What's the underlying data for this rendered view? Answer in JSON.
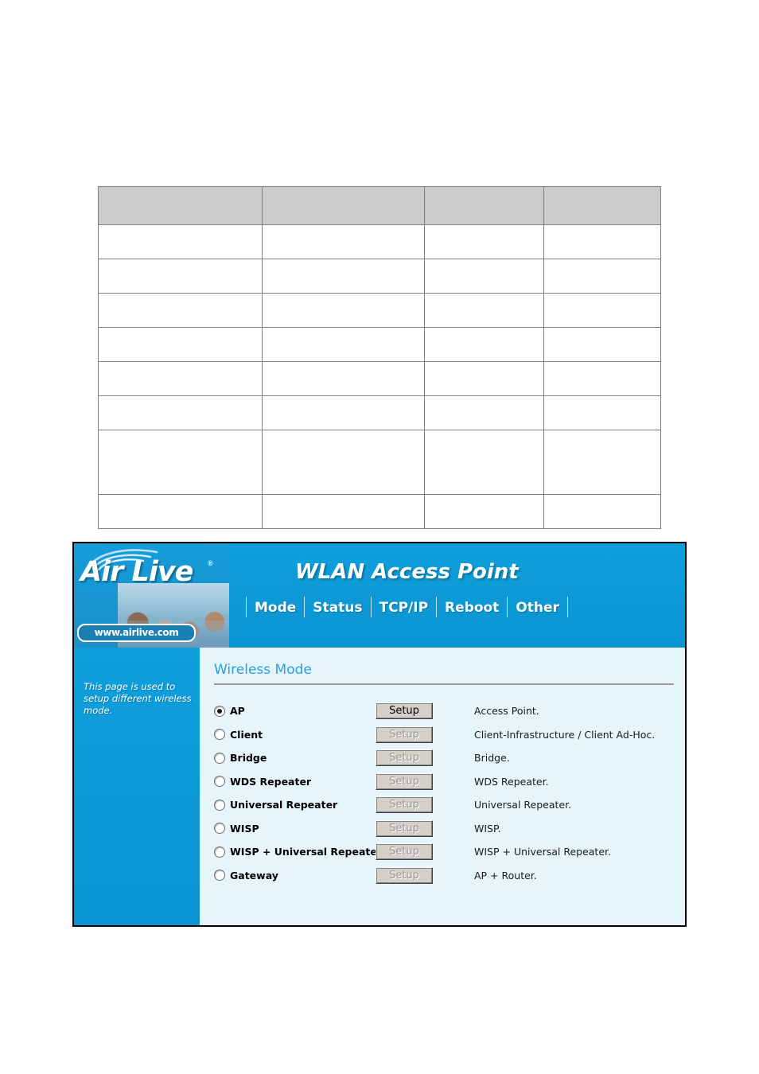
{
  "spec_table": {
    "header_cells": [
      "",
      "",
      "",
      ""
    ],
    "rows": [
      {
        "cells": [
          "",
          "",
          "",
          ""
        ],
        "tall": false
      },
      {
        "cells": [
          "",
          "",
          "",
          ""
        ],
        "tall": false
      },
      {
        "cells": [
          "",
          "",
          "",
          ""
        ],
        "tall": false
      },
      {
        "cells": [
          "",
          "",
          "",
          ""
        ],
        "tall": false
      },
      {
        "cells": [
          "",
          "",
          "",
          ""
        ],
        "tall": false
      },
      {
        "cells": [
          "",
          "",
          "",
          ""
        ],
        "tall": false
      },
      {
        "cells": [
          "",
          "",
          "",
          ""
        ],
        "tall": true
      },
      {
        "cells": [
          "",
          "",
          "",
          ""
        ],
        "tall": false
      }
    ]
  },
  "router_ui": {
    "brand": {
      "name": "Air Live",
      "registered_mark": "®",
      "url": "www.airlive.com",
      "logo_icon": "wifi-waves-icon",
      "photo_icon": "people-photo"
    },
    "title": "WLAN Access Point",
    "nav": [
      {
        "label": "Mode"
      },
      {
        "label": "Status"
      },
      {
        "label": "TCP/IP"
      },
      {
        "label": "Reboot"
      },
      {
        "label": "Other"
      }
    ],
    "sidebar": {
      "help_text": "This page is used to setup different wireless mode."
    },
    "content": {
      "heading": "Wireless Mode",
      "setup_label": "Setup",
      "modes": [
        {
          "label": "AP",
          "selected": true,
          "setup_enabled": true,
          "description": "Access Point."
        },
        {
          "label": "Client",
          "selected": false,
          "setup_enabled": false,
          "description": "Client-Infrastructure / Client Ad-Hoc."
        },
        {
          "label": "Bridge",
          "selected": false,
          "setup_enabled": false,
          "description": "Bridge."
        },
        {
          "label": "WDS Repeater",
          "selected": false,
          "setup_enabled": false,
          "description": "WDS Repeater."
        },
        {
          "label": "Universal Repeater",
          "selected": false,
          "setup_enabled": false,
          "description": "Universal Repeater."
        },
        {
          "label": "WISP",
          "selected": false,
          "setup_enabled": false,
          "description": "WISP."
        },
        {
          "label": "WISP + Universal Repeater",
          "selected": false,
          "setup_enabled": false,
          "description": "WISP + Universal Repeater."
        },
        {
          "label": "Gateway",
          "selected": false,
          "setup_enabled": false,
          "description": "AP + Router."
        }
      ]
    }
  },
  "colors": {
    "header_blue": "#0c9bd9",
    "sidebar_blue": "#0b9ad8",
    "content_bg": "#e6f5fc",
    "heading_blue": "#2b9ede",
    "table_header_gray": "#cccccc",
    "table_border_gray": "#808080",
    "button_face": "#d4d0c8"
  }
}
